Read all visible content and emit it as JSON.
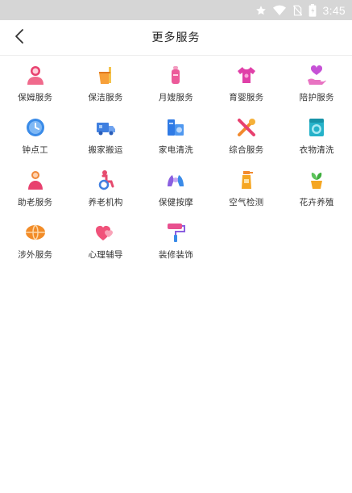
{
  "status_bar": {
    "time": "3:45",
    "icons": [
      "star-icon",
      "wifi-icon",
      "no-sim-icon",
      "battery-icon"
    ]
  },
  "header": {
    "back_icon": "chevron-left-icon",
    "title": "更多服务"
  },
  "services": [
    {
      "label": "保姆服务",
      "icon": "nanny-icon",
      "color": "#e8416f"
    },
    {
      "label": "保洁服务",
      "icon": "cleaning-bucket-icon",
      "color": "#f7a03a"
    },
    {
      "label": "月嫂服务",
      "icon": "baby-bottle-icon",
      "color": "#ec5a9a"
    },
    {
      "label": "育婴服务",
      "icon": "baby-clothes-icon",
      "color": "#e040a8"
    },
    {
      "label": "陪护服务",
      "icon": "hand-heart-icon",
      "color": "#c651d6"
    },
    {
      "label": "钟点工",
      "icon": "clock-icon",
      "color": "#3a8be8"
    },
    {
      "label": "搬家搬运",
      "icon": "moving-truck-icon",
      "color": "#3f7fe0"
    },
    {
      "label": "家电清洗",
      "icon": "appliance-icon",
      "color": "#2f7ae5"
    },
    {
      "label": "综合服务",
      "icon": "tools-icon",
      "color": "#f28a2e"
    },
    {
      "label": "衣物清洗",
      "icon": "washing-machine-icon",
      "color": "#25b2c9"
    },
    {
      "label": "助老服务",
      "icon": "elderly-helper-icon",
      "color": "#f0893a"
    },
    {
      "label": "养老机构",
      "icon": "wheelchair-icon",
      "color": "#e64b6e"
    },
    {
      "label": "保健按摩",
      "icon": "massage-icon",
      "color": "#8a5fe0"
    },
    {
      "label": "空气检测",
      "icon": "spray-bottle-icon",
      "color": "#f5a623"
    },
    {
      "label": "花卉养殖",
      "icon": "flower-pot-icon",
      "color": "#f5a623"
    },
    {
      "label": "涉外服务",
      "icon": "globe-icon",
      "color": "#f28c28"
    },
    {
      "label": "心理辅导",
      "icon": "hearts-icon",
      "color": "#f0527a"
    },
    {
      "label": "装修装饰",
      "icon": "paint-roller-icon",
      "color": "#e8508f"
    }
  ]
}
